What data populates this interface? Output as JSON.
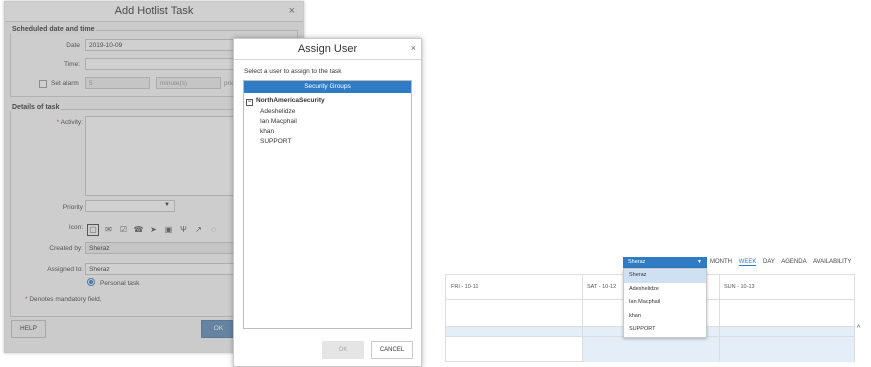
{
  "hotlist": {
    "title": "Add Hotlist Task",
    "close": "×",
    "scheduled_legend": "Scheduled date and time",
    "date_label": "Date",
    "date_value": "2019-10-09",
    "time_label": "Time:",
    "alarm_label": "Set alarm",
    "alarm_value": "5",
    "alarm_unit": "minute(s)",
    "alarm_suffix": "prior",
    "details_legend": "Details of task",
    "activity_required": "*",
    "activity_label": "Activity:",
    "priority_label": "Priority",
    "icon_label": "Icon:",
    "created_label": "Created by:",
    "created_value": "Sheraz",
    "assigned_label": "Assigned to:",
    "assigned_value": "Sheraz",
    "personal_task": "Personal task",
    "mandatory_mark": "*",
    "mandatory_note": "Denotes mandatory field.",
    "help": "HELP",
    "ok": "OK"
  },
  "assign": {
    "title": "Assign User",
    "close": "×",
    "prompt": "Select a user to assign to the task",
    "header": "Security Groups",
    "root": "NorthAmericaSecurity",
    "users": [
      "Adeshelidze",
      "Ian Macphail",
      "khan",
      "SUPPORT"
    ],
    "ok": "OK",
    "cancel": "CANCEL"
  },
  "calendar": {
    "selected_user": "Sheraz",
    "users": [
      "Sheraz",
      "Adeshelidze",
      "Ian Macphail",
      "khan",
      "SUPPORT"
    ],
    "views": [
      "MONTH",
      "WEEK",
      "DAY",
      "AGENDA",
      "AVAILABILITY"
    ],
    "active_view": "WEEK",
    "days": [
      "FRI - 10-11",
      "SAT - 10-12",
      "SUN - 10-13"
    ]
  },
  "icons": [
    "square-icon",
    "envelope-icon",
    "calendar-check-icon",
    "phone-icon",
    "send-icon",
    "money-icon",
    "cutlery-icon",
    "chart-icon",
    "comment-icon"
  ]
}
